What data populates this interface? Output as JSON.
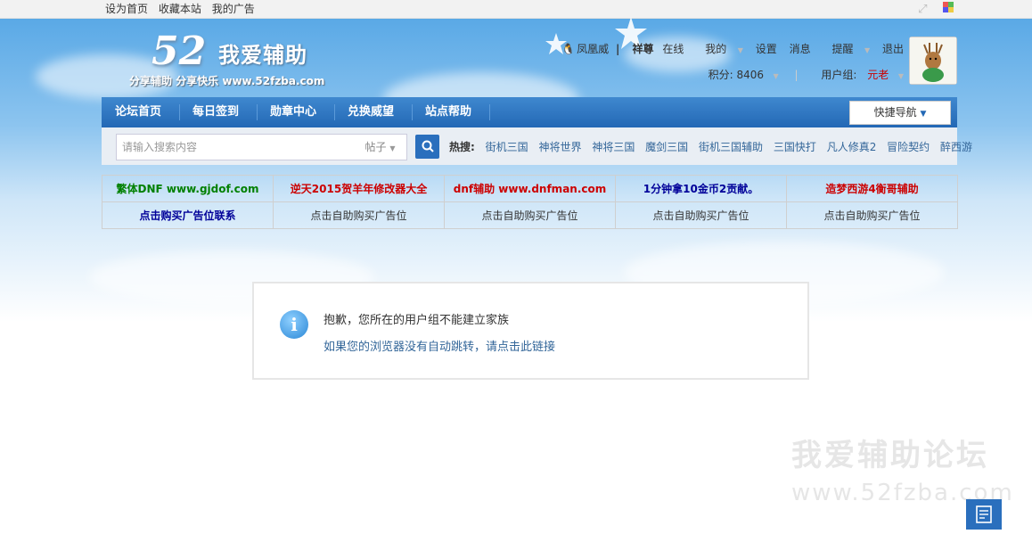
{
  "topbar": {
    "links": [
      "设为首页",
      "收藏本站",
      "我的广告"
    ]
  },
  "logo": {
    "number": "52",
    "name": "我爱辅助",
    "slogan": "分享辅助  分享快乐  www.52fzba.com"
  },
  "user": {
    "username": "凤凰威",
    "title": "祥尊",
    "status": "在线",
    "menu": [
      "我的",
      "设置",
      "消息",
      "提醒",
      "退出"
    ],
    "points_label": "积分: 8406",
    "group_label": "用户组:",
    "group_value": "元老"
  },
  "nav": {
    "items": [
      "论坛首页",
      "每日签到",
      "勋章中心",
      "兑换威望",
      "站点帮助"
    ],
    "quick_nav": "快捷导航"
  },
  "search": {
    "placeholder": "请输入搜索内容",
    "scope": "帖子",
    "hot_label": "热搜:",
    "hot": [
      "街机三国",
      "神将世界",
      "神将三国",
      "魔剑三国",
      "街机三国辅助",
      "三国快打",
      "凡人修真2",
      "冒险契约",
      "醉西游"
    ]
  },
  "ads": {
    "row1": [
      {
        "text": "繁体DNF www.gjdof.com",
        "color": "#008000"
      },
      {
        "text": "逆天2015贺羊年修改器大全",
        "color": "#cc0000"
      },
      {
        "text": "dnf辅助 www.dnfman.com",
        "color": "#cc0000"
      },
      {
        "text": "1分钟拿10金币2贡献。",
        "color": "#000099"
      },
      {
        "text": "造梦西游4衡哥辅助",
        "color": "#cc0000"
      }
    ],
    "row2": [
      {
        "text": "点击购买广告位联系",
        "color": "#000099"
      },
      {
        "text": "点击自助购买广告位",
        "color": "#333333"
      },
      {
        "text": "点击自助购买广告位",
        "color": "#333333"
      },
      {
        "text": "点击自助购买广告位",
        "color": "#333333"
      },
      {
        "text": "点击自助购买广告位",
        "color": "#333333"
      }
    ]
  },
  "message": {
    "text": "抱歉，您所在的用户组不能建立家族",
    "link": "如果您的浏览器没有自动跳转，请点击此链接"
  },
  "watermark": {
    "title": "我爱辅助论坛",
    "url": "www.52fzba.com"
  }
}
